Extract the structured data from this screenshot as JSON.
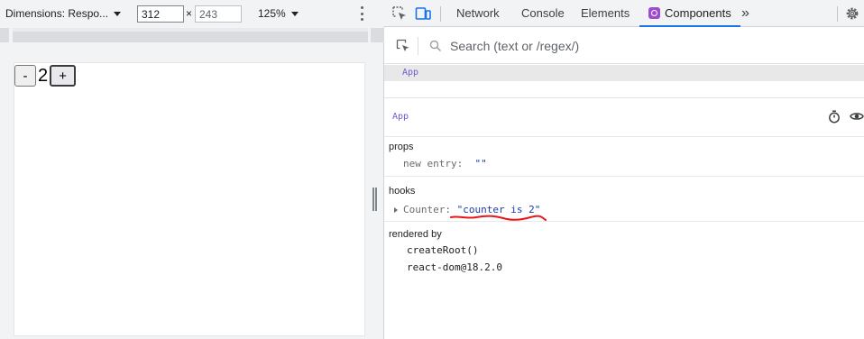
{
  "device_toolbar": {
    "dimensions_label": "Dimensions: Respo...",
    "width_value": "312",
    "height_value": "243",
    "times_symbol": "×",
    "zoom_label": "125%"
  },
  "counter_app": {
    "minus_label": "-",
    "count": "2",
    "plus_label": "+"
  },
  "devtools_tabs": [
    {
      "label": "Network"
    },
    {
      "label": "Console"
    },
    {
      "label": "Elements"
    },
    {
      "label": "Components",
      "active": true
    }
  ],
  "more_tabs": "»",
  "search": {
    "placeholder": "Search (text or /regex/)"
  },
  "component_tree": {
    "root": "App"
  },
  "inspected": {
    "name": "App",
    "props_title": "props",
    "props": [
      {
        "key": "new entry",
        "value": "\"\""
      }
    ],
    "hooks_title": "hooks",
    "hooks": [
      {
        "key": "Counter",
        "value": "\"counter is 2\""
      }
    ],
    "rendered_by_title": "rendered by",
    "rendered_by": [
      "createRoot()",
      "react-dom@18.2.0"
    ]
  },
  "colors": {
    "accent": "#1a73e8",
    "component_purple": "#6b5bd1",
    "string_blue": "#1c3aa9",
    "annotation_red": "#e8141a"
  }
}
